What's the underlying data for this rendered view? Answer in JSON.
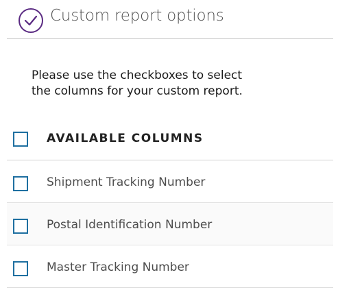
{
  "header": {
    "title": "Custom report options",
    "icon": "check-circle-icon",
    "accent_color": "#5a2a82"
  },
  "instructions": {
    "line1": "Please use the checkboxes to select",
    "line2": "the columns for your custom report."
  },
  "table": {
    "header_label": "AVAILABLE COLUMNS",
    "checkbox_color": "#1e6fa0",
    "rows": [
      {
        "label": "Shipment Tracking Number",
        "checked": false
      },
      {
        "label": "Postal Identification Number",
        "checked": false
      },
      {
        "label": "Master Tracking Number",
        "checked": false
      }
    ]
  }
}
